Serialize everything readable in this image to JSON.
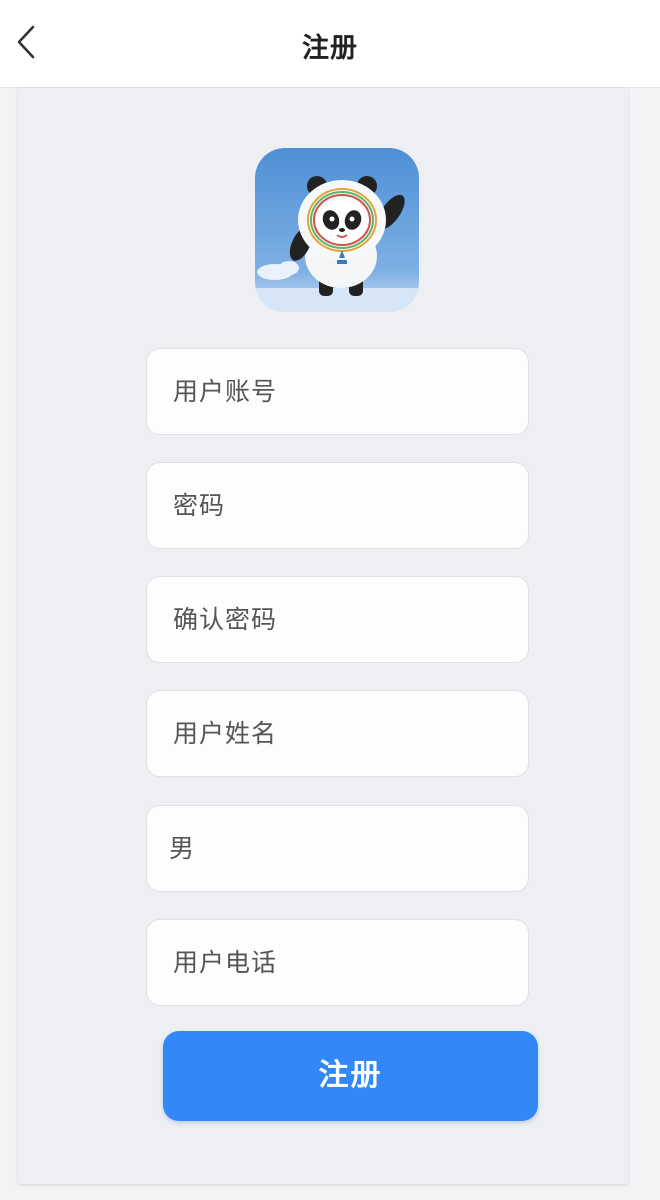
{
  "header": {
    "title": "注册",
    "back_icon": "chevron-left-icon"
  },
  "avatar": {
    "icon": "panda-mascot-icon"
  },
  "form": {
    "username_placeholder": "用户账号",
    "password_placeholder": "密码",
    "confirm_password_placeholder": "确认密码",
    "name_placeholder": "用户姓名",
    "gender_value": "男",
    "phone_placeholder": "用户电话"
  },
  "submit": {
    "label": "注册"
  },
  "colors": {
    "accent": "#3288f7",
    "background": "#f3f3f5",
    "card": "#eeeff2",
    "header": "#ffffff"
  }
}
